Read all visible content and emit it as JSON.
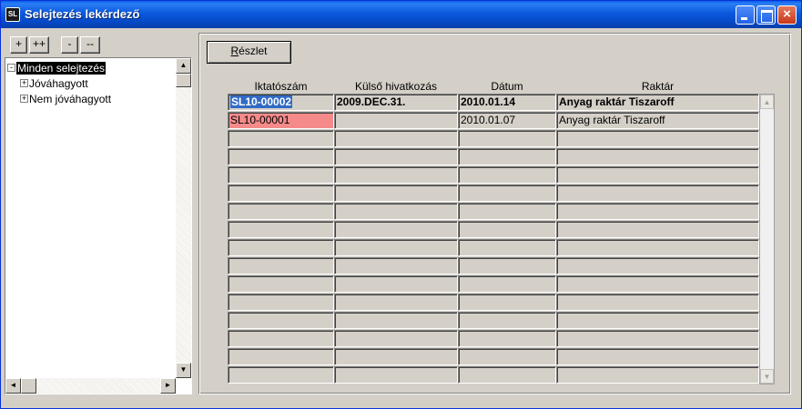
{
  "window": {
    "icon_text": "SL",
    "title": "Selejtezés lekérdező",
    "controls": {
      "minimize": "",
      "maximize": "",
      "close": "×"
    }
  },
  "tree_buttons": [
    "+",
    "++",
    "-",
    "--"
  ],
  "tree": {
    "nodes": [
      {
        "label": "Minden selejtezés",
        "toggle": "-",
        "selected": true
      },
      {
        "label": "Jóváhagyott",
        "toggle": "+"
      },
      {
        "label": "Nem jóváhagyott",
        "toggle": "+"
      }
    ]
  },
  "detail_button": {
    "accel": "R",
    "rest": "észlet"
  },
  "table": {
    "columns": [
      "Iktatószám",
      "Külső hivatkozás",
      "Dátum",
      "Raktár"
    ],
    "rows": [
      {
        "iktatoszam": "SL10-00002",
        "kulso": "2009.DEC.31.",
        "datum": "2010.01.14",
        "raktar": "Anyag raktár Tiszaroff",
        "bold": true,
        "selected": true
      },
      {
        "iktatoszam": "SL10-00001",
        "kulso": "",
        "datum": "2010.01.07",
        "raktar": "Anyag raktár Tiszaroff",
        "highlight": "#f48a8a"
      }
    ],
    "empty_rows": 14
  },
  "scroll_glyphs": {
    "up": "▲",
    "down": "▼",
    "left": "◄",
    "right": "►"
  },
  "colors": {
    "title_bar": "#0b59dd",
    "selection": "#316ac5",
    "row_highlight": "#f48a8a",
    "face": "#d4d0c8"
  }
}
